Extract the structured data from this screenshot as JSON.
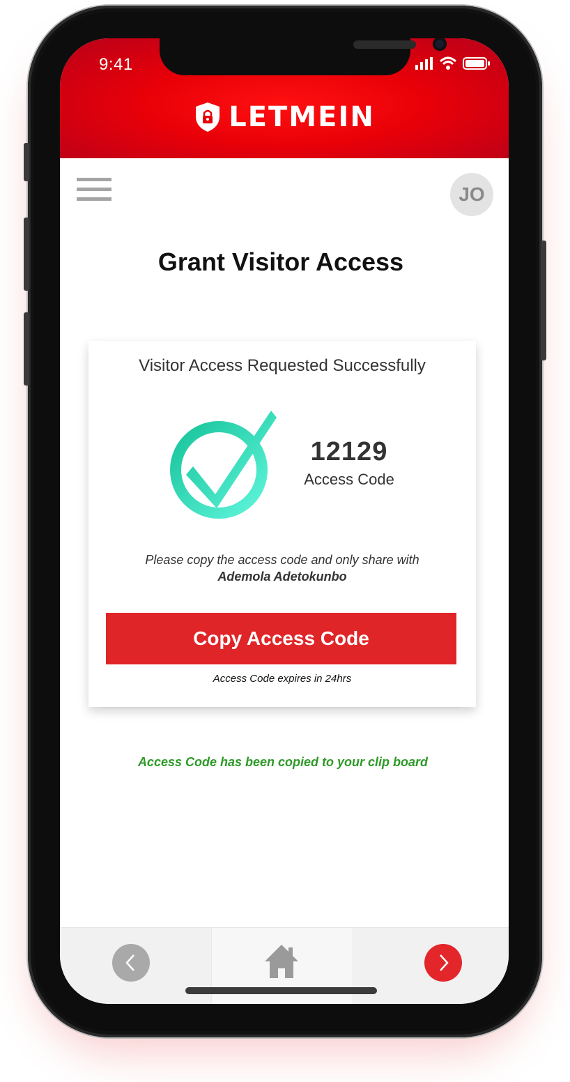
{
  "status_bar": {
    "time": "9:41"
  },
  "header": {
    "brand": "LETMEIN"
  },
  "user": {
    "initials": "JO"
  },
  "page": {
    "title": "Grant Visitor Access"
  },
  "card": {
    "heading": "Visitor Access Requested Successfully",
    "access_code": "12129",
    "access_code_label": "Access Code",
    "note_line1": "Please copy the access code and only share with",
    "note_name": "Ademola Adetokunbo",
    "copy_button": "Copy Access Code",
    "expiry": "Access Code expires in 24hrs"
  },
  "toast": {
    "message": "Access Code has been copied to your clip board"
  },
  "colors": {
    "brand_red": "#e80008",
    "button_red": "#e02528",
    "success_green": "#2e9a27",
    "check_teal": "#2ad0b0"
  },
  "icons": [
    "lock-shield-icon",
    "menu-icon",
    "check-icon",
    "chevron-left-icon",
    "home-icon",
    "chevron-right-icon",
    "signal-icon",
    "wifi-icon",
    "battery-icon"
  ]
}
